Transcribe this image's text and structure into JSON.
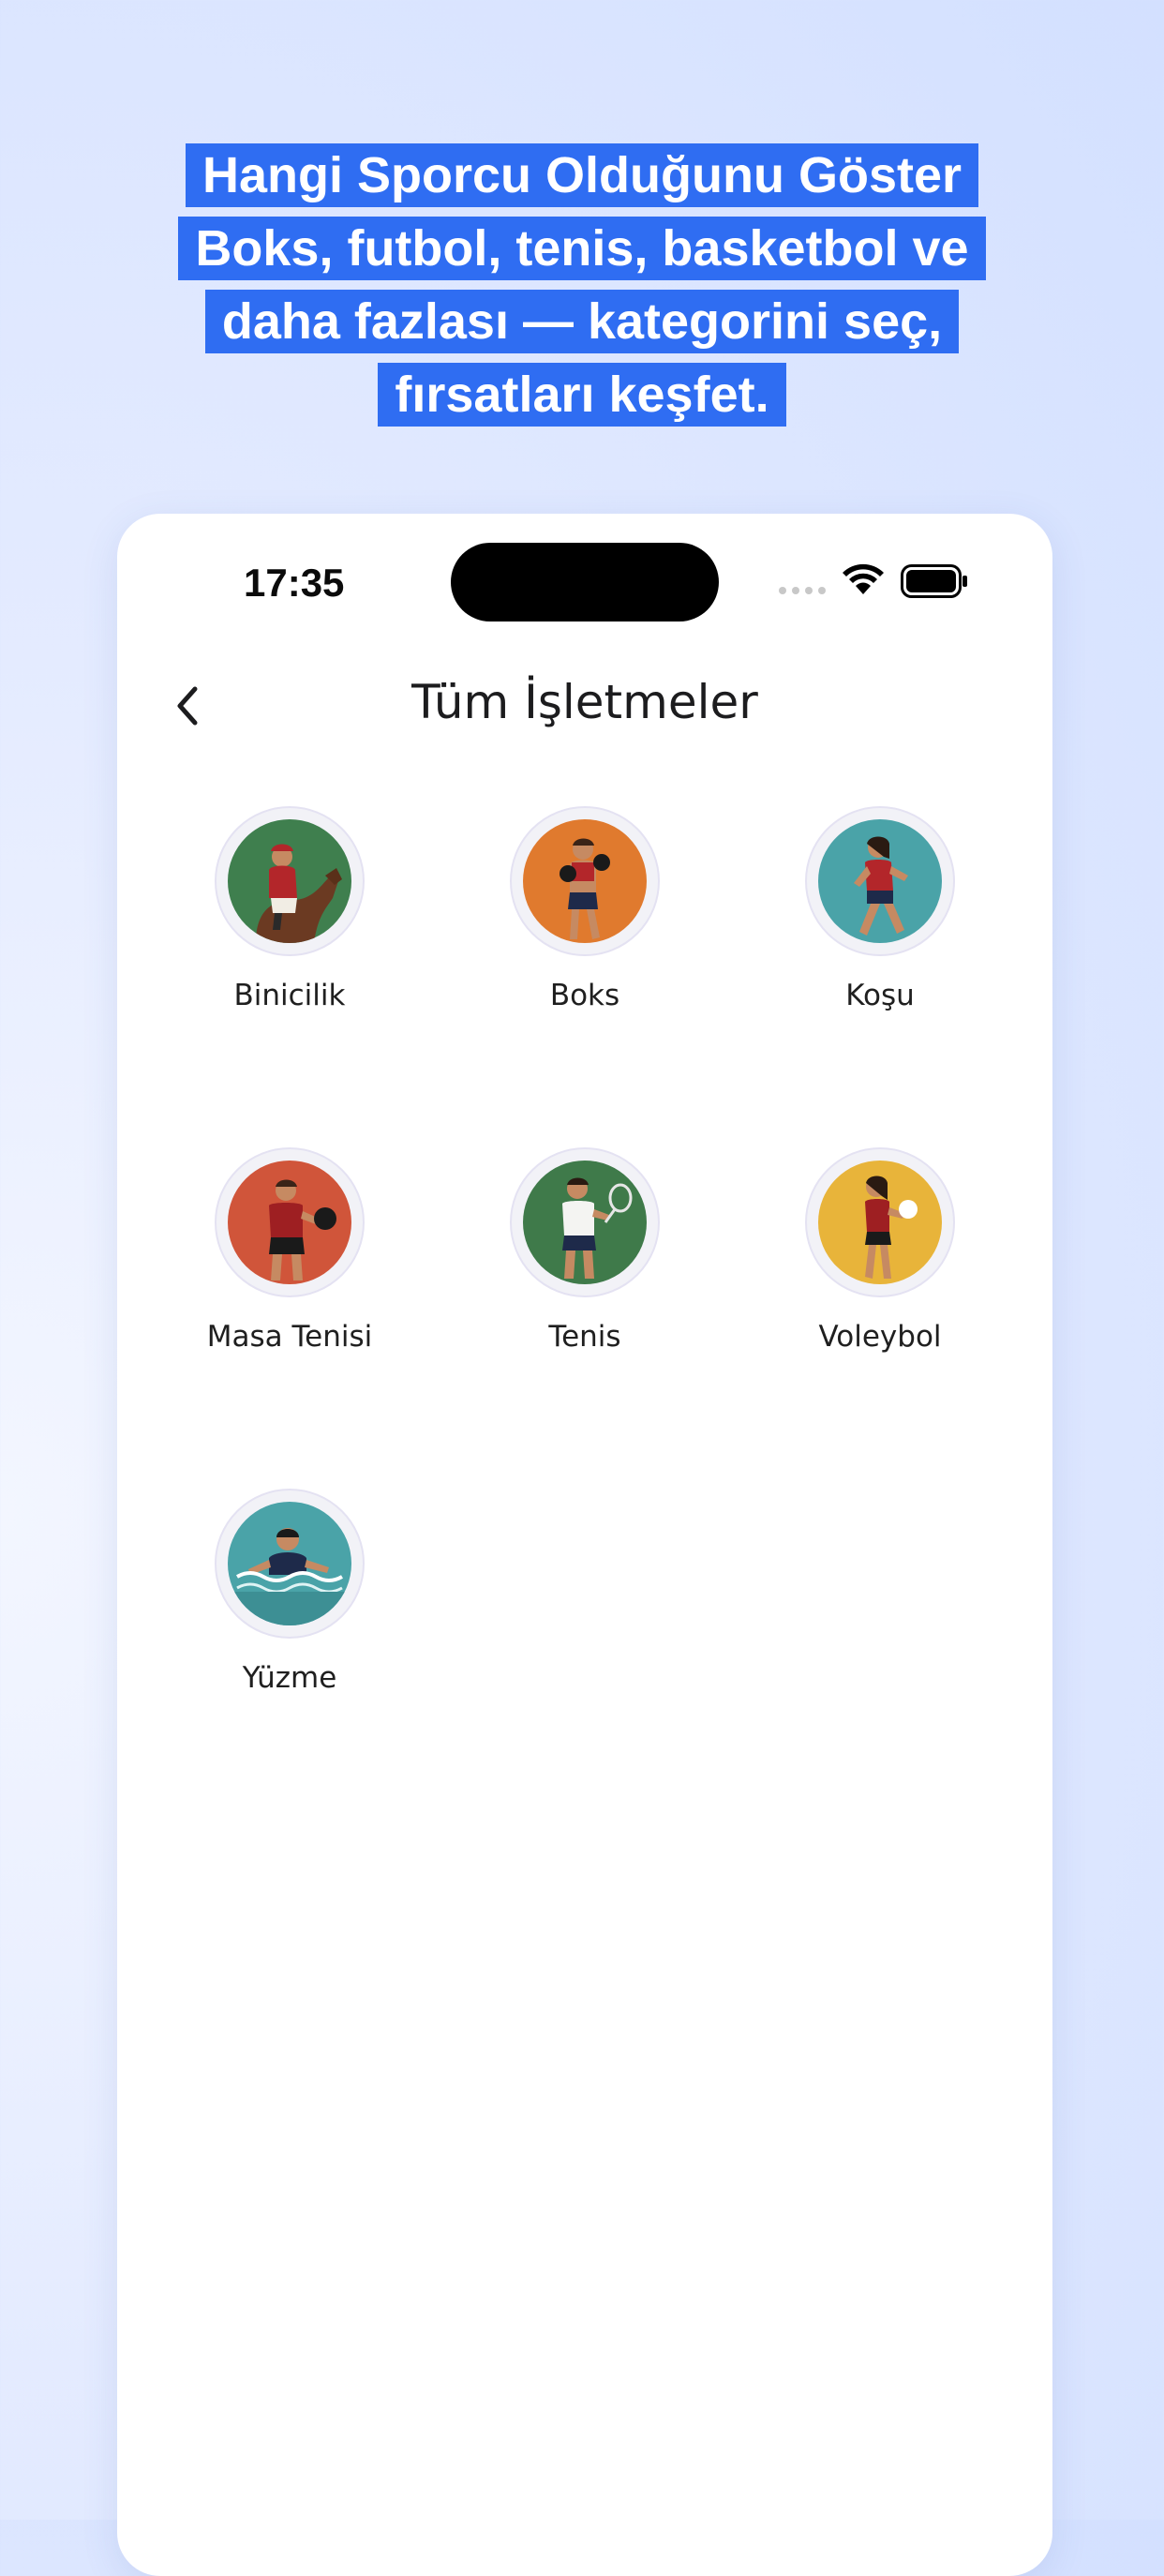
{
  "promo": {
    "line1": "Hangi Sporcu Olduğunu Göster",
    "line2": "Boks, futbol, tenis, basketbol ve",
    "line3": "daha fazlası — kategorini seç,",
    "line4": "fırsatları keşfet."
  },
  "status_bar": {
    "time": "17:35",
    "icons": [
      "cellular-dots-icon",
      "wifi-icon",
      "battery-icon"
    ]
  },
  "header": {
    "back_icon": "chevron-left-icon",
    "title": "Tüm İşletmeler"
  },
  "colors": {
    "headline_bg": "#2f6df2",
    "headline_text": "#ffffff",
    "binicilik": "#3f7f4e",
    "boks": "#e07a2e",
    "kosu": "#4aa3a8",
    "masa_tenisi": "#d0553a",
    "tenis": "#3f7a4a",
    "voleybol": "#e8b43a",
    "yuzme": "#4aa3a8"
  },
  "categories": [
    {
      "label": "Binicilik",
      "icon": "horse-rider-icon"
    },
    {
      "label": "Boks",
      "icon": "boxer-icon"
    },
    {
      "label": "Koşu",
      "icon": "runner-icon"
    },
    {
      "label": "Masa Tenisi",
      "icon": "table-tennis-player-icon"
    },
    {
      "label": "Tenis",
      "icon": "tennis-player-icon"
    },
    {
      "label": "Voleybol",
      "icon": "volleyball-player-icon"
    },
    {
      "label": "Yüzme",
      "icon": "swimmer-icon"
    }
  ]
}
